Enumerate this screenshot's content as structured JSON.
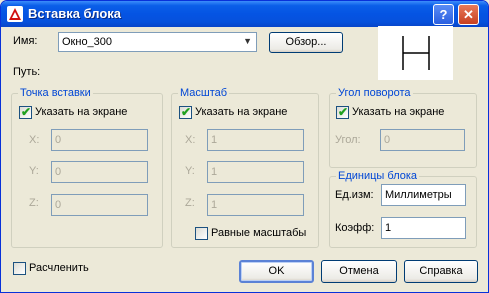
{
  "window": {
    "title": "Вставка блока",
    "help_label": "?",
    "close_label": "✕"
  },
  "name": {
    "label": "Имя:",
    "value": "Окно_300",
    "browse_label": "Обзор..."
  },
  "path": {
    "label": "Путь:"
  },
  "insertion_point": {
    "title": "Точка вставки",
    "specify_label": "Указать на экране",
    "specify_checked": true,
    "x_label": "X:",
    "x_value": "0",
    "y_label": "Y:",
    "y_value": "0",
    "z_label": "Z:",
    "z_value": "0"
  },
  "scale": {
    "title": "Масштаб",
    "specify_label": "Указать на экране",
    "specify_checked": true,
    "x_label": "X:",
    "x_value": "1",
    "y_label": "Y:",
    "y_value": "1",
    "z_label": "Z:",
    "z_value": "1",
    "uniform_label": "Равные масштабы",
    "uniform_checked": false
  },
  "rotation": {
    "title": "Угол поворота",
    "specify_label": "Указать на экране",
    "specify_checked": true,
    "angle_label": "Угол:",
    "angle_value": "0"
  },
  "block_units": {
    "title": "Единицы блока",
    "unit_label": "Ед.изм:",
    "unit_value": "Миллиметры",
    "factor_label": "Коэфф:",
    "factor_value": "1"
  },
  "explode": {
    "label": "Расчленить",
    "checked": false
  },
  "buttons": {
    "ok": "OK",
    "cancel": "Отмена",
    "help": "Справка"
  },
  "colors": {
    "titlebar": "#0554e3",
    "group_title": "#0046d5",
    "dialog_bg": "#ece9d8",
    "check": "#21a121"
  }
}
